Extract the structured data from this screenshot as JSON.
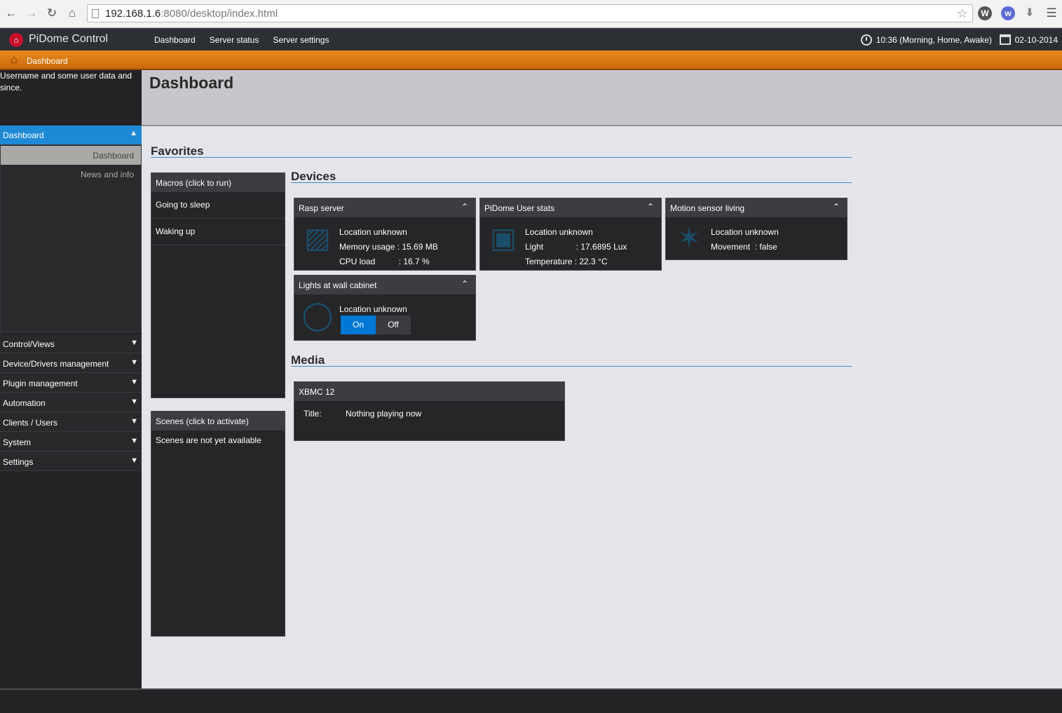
{
  "browser": {
    "url_host": "192.168.1.6",
    "url_rest": ":8080/desktop/index.html"
  },
  "app": {
    "title": "PiDome Control",
    "nav": [
      "Dashboard",
      "Server status",
      "Server settings"
    ],
    "clock": "10:36 (Morning, Home, Awake)",
    "date": "02-10-2014"
  },
  "breadcrumb": {
    "label": "Dashboard"
  },
  "sidebar": {
    "user_info": "Username and some user data and since.",
    "active_section": "Dashboard",
    "sub_active": "Dashboard",
    "sub_item": "News and info",
    "items": [
      "Control/Views",
      "Device/Drivers management",
      "Plugin management",
      "Automation",
      "Clients / Users",
      "System",
      "Settings"
    ]
  },
  "page": {
    "title": "Dashboard"
  },
  "favorites": {
    "title": "Favorites",
    "macros": {
      "title": "Macros (click to run)",
      "items": [
        "Going to sleep",
        "Waking up"
      ]
    },
    "scenes": {
      "title": "Scenes (click to activate)",
      "empty": "Scenes are not yet available"
    }
  },
  "devices": {
    "title": "Devices",
    "rasp": {
      "title": "Rasp server",
      "location": "Location unknown",
      "memory": "Memory usage : 15.69 MB",
      "cpu": "CPU load          : 16.7 %"
    },
    "userstats": {
      "title": "PiDome User stats",
      "location": "Location unknown",
      "light": "Light              : 17.6895 Lux",
      "temperature": "Temperature : 22.3 °C"
    },
    "motion": {
      "title": "Motion sensor living",
      "location": "Location unknown",
      "movement": "Movement  : false"
    },
    "lights": {
      "title": "Lights at wall cabinet",
      "location": "Location unknown",
      "on_label": "On",
      "off_label": "Off"
    }
  },
  "media": {
    "title": "Media",
    "player": {
      "title": "XBMC 12",
      "field_label": "Title:",
      "field_value": "Nothing playing now"
    }
  },
  "colors": {
    "accent": "#1e8ad6",
    "orange": "#e98a1c",
    "toggle_on": "#0078d7"
  }
}
